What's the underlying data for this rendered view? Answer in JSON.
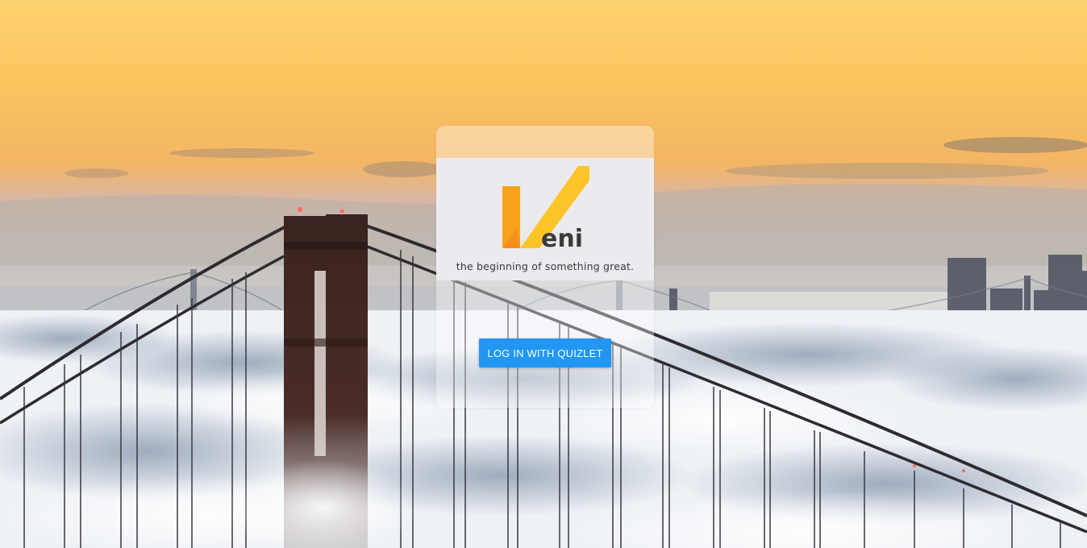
{
  "logo": {
    "wordmark": "eni",
    "tagline": "the beginning of something great."
  },
  "login": {
    "button_label": "LOG IN WITH QUIZLET"
  },
  "colors": {
    "accent": "#2196f3",
    "logo_orange": "#f7a21b",
    "logo_yellow": "#fbc52a"
  },
  "background": {
    "icon": "golden-gate-bridge-fog-photo"
  }
}
